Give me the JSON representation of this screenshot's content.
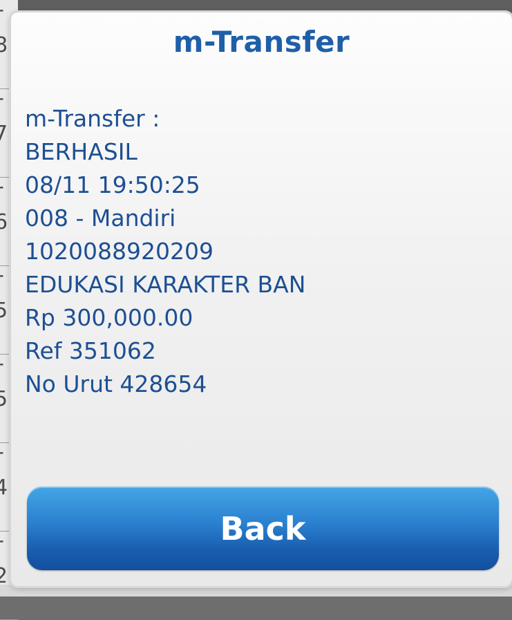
{
  "dialog": {
    "title": "m-Transfer",
    "message_lines": [
      "m-Transfer :",
      "BERHASIL",
      "08/11 19:50:25",
      "008 - Mandiri",
      "1020088920209",
      "EDUKASI KARAKTER BAN",
      "Rp 300,000.00",
      "Ref 351062",
      "No Urut 428654"
    ],
    "back_label": "Back"
  },
  "colors": {
    "title_text": "#1f5fa8",
    "message_text": "#1d4f93",
    "button_top": "#43a6e6",
    "button_bottom": "#134f9e"
  }
}
